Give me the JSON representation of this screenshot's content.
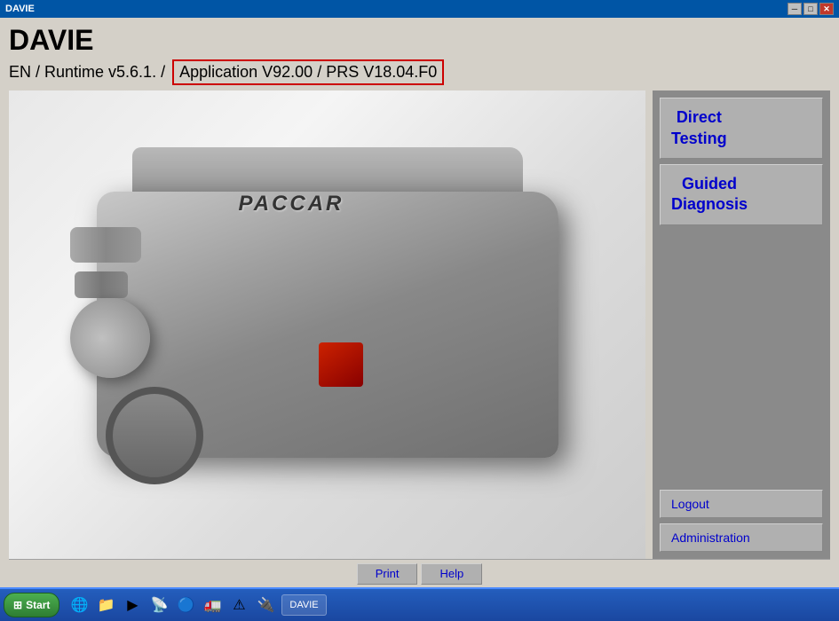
{
  "titleBar": {
    "label": "DAVIE",
    "minBtn": "─",
    "maxBtn": "□",
    "closeBtn": "✕"
  },
  "header": {
    "appTitle": "DAVIE",
    "prefix": "EN / Runtime v5.6.1. /",
    "versionBox": "Application V92.00 / PRS V18.04.F0"
  },
  "rightPanel": {
    "btn1Line1": "Direct",
    "btn1Line2": "Testing",
    "btn2Line1": "Guided",
    "btn2Line2": "Diagnosis",
    "logoutLabel": "Logout",
    "adminLabel": "Administration"
  },
  "bottomToolbar": {
    "printLabel": "Print",
    "helpLabel": "Help"
  },
  "taskbar": {
    "startLabel": "Start",
    "davieTaskLabel": "DAVIE"
  },
  "engine": {
    "brand": "PACCAR"
  }
}
